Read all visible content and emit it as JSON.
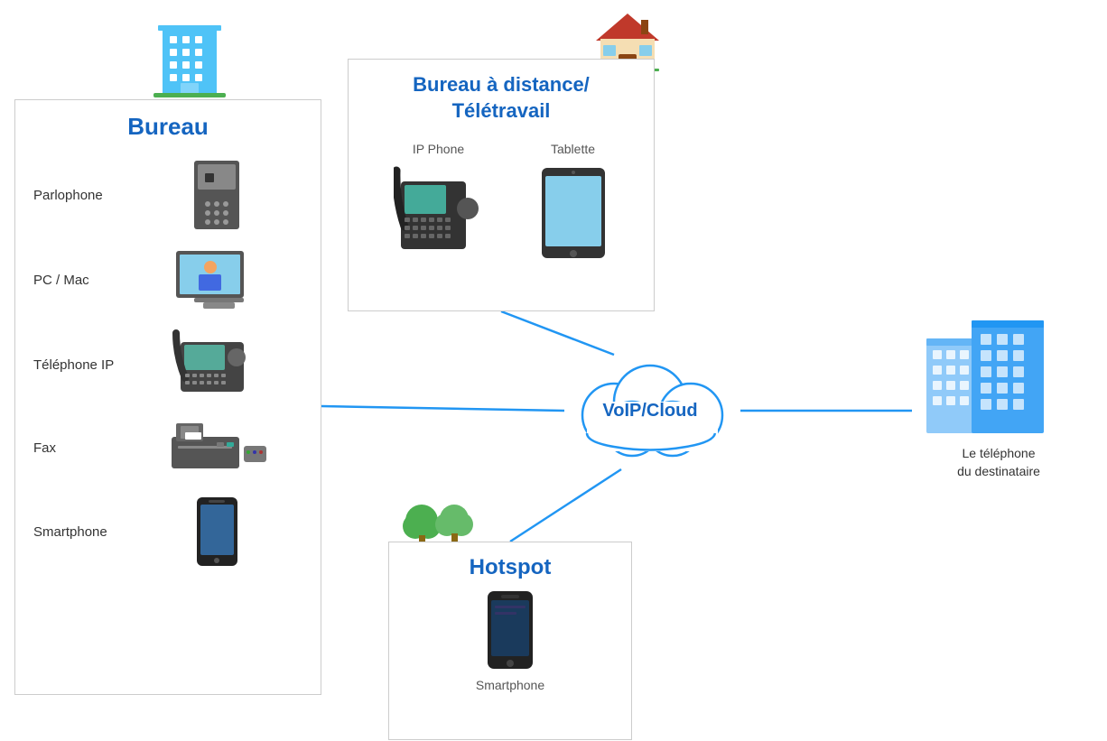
{
  "bureau": {
    "title": "Bureau",
    "items": [
      {
        "id": "parlophone",
        "label": "Parlophone",
        "emoji": "🔲",
        "icon_type": "parlophone"
      },
      {
        "id": "pc-mac",
        "label": "PC / Mac",
        "emoji": "💻",
        "icon_type": "pc"
      },
      {
        "id": "telephone-ip",
        "label": "Téléphone IP",
        "emoji": "📞",
        "icon_type": "ipphone"
      },
      {
        "id": "fax",
        "label": "Fax",
        "emoji": "🖨",
        "icon_type": "fax"
      },
      {
        "id": "smartphone",
        "label": "Smartphone",
        "emoji": "📱",
        "icon_type": "smartphone"
      }
    ]
  },
  "remote": {
    "title_line1": "Bureau à distance/",
    "title_line2": "Télétravail",
    "items": [
      {
        "id": "ip-phone",
        "label": "IP Phone",
        "emoji": "☎"
      },
      {
        "id": "tablette",
        "label": "Tablette",
        "emoji": "📱"
      }
    ]
  },
  "hotspot": {
    "title": "Hotspot",
    "items": [
      {
        "id": "smartphone-hotspot",
        "label": "Smartphone",
        "emoji": "📱"
      }
    ]
  },
  "voip": {
    "label": "VoIP/Cloud"
  },
  "destination": {
    "label": "Le téléphone\ndu destinataire"
  },
  "colors": {
    "blue": "#1565C0",
    "line_blue": "#2196F3",
    "border": "#cccccc"
  }
}
